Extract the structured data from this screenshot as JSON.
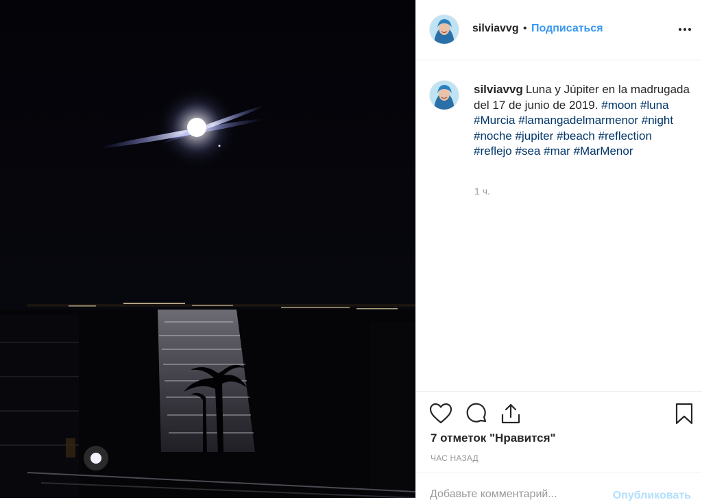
{
  "header": {
    "username": "silviavvg",
    "separator": "•",
    "follow_label": "Подписаться"
  },
  "caption": {
    "username": "silviavvg",
    "text": "Luna y Júpiter en la madrugada del 17 de junio de 2019.",
    "hashtags": [
      "#moon",
      "#luna",
      "#Murcia",
      "#lamangadelmarmenor",
      "#night",
      "#noche",
      "#jupiter",
      "#beach",
      "#reflection",
      "#reflejo",
      "#sea",
      "#mar",
      "#MarMenor"
    ],
    "time": "1 ч."
  },
  "actions": {
    "likes_text": "7 отметок \"Нравится\"",
    "time_ago": "ЧАС НАЗАД"
  },
  "comment": {
    "placeholder": "Добавьте комментарий...",
    "publish_label": "Опубликовать"
  },
  "icons": {
    "like": "heart-icon",
    "comment": "comment-icon",
    "share": "share-icon",
    "save": "bookmark-icon",
    "more": "more-options-icon"
  },
  "colors": {
    "accent": "#3897f0",
    "hashtag": "#003569",
    "muted": "#999999",
    "publish_disabled": "#b2dffc"
  }
}
